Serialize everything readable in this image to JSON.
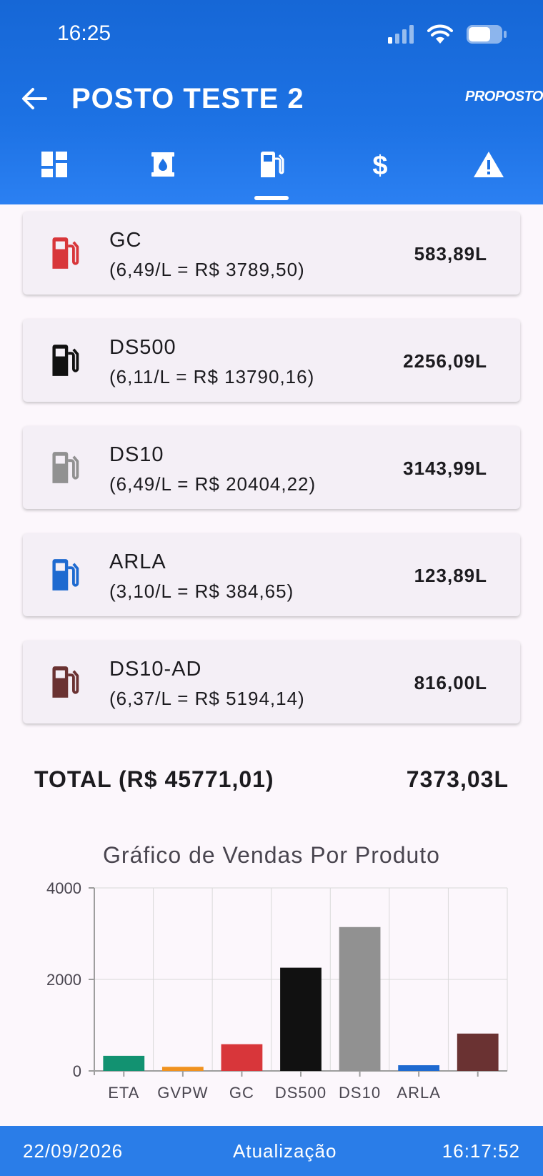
{
  "status": {
    "time": "16:25"
  },
  "header": {
    "title": "POSTO TESTE 2",
    "logo": "PROPOSTO"
  },
  "tabs": [
    {
      "icon": "dashboard-icon"
    },
    {
      "icon": "tank-icon"
    },
    {
      "icon": "fuel-pump-icon",
      "active": true
    },
    {
      "icon": "dollar-icon"
    },
    {
      "icon": "warning-icon"
    }
  ],
  "products": [
    {
      "name": "GC",
      "detail": "(6,49/L = R$ 3789,50)",
      "volume": "583,89L",
      "color": "#d8363a"
    },
    {
      "name": "DS500",
      "detail": "(6,11/L = R$ 13790,16)",
      "volume": "2256,09L",
      "color": "#111111"
    },
    {
      "name": "DS10",
      "detail": "(6,49/L = R$ 20404,22)",
      "volume": "3143,99L",
      "color": "#919191"
    },
    {
      "name": "ARLA",
      "detail": "(3,10/L = R$ 384,65)",
      "volume": "123,89L",
      "color": "#1e6ad0"
    },
    {
      "name": "DS10-AD",
      "detail": "(6,37/L = R$ 5194,14)",
      "volume": "816,00L",
      "color": "#6a3232"
    }
  ],
  "total": {
    "label": "TOTAL (R$ 45771,01)",
    "volume": "7373,03L"
  },
  "chart_data": {
    "type": "bar",
    "title": "Gráfico de Vendas Por Produto",
    "categories": [
      "ETA",
      "GVPW",
      "GC",
      "DS500",
      "DS10",
      "ARLA",
      ""
    ],
    "values": [
      330,
      90,
      584,
      2256,
      3144,
      124,
      816
    ],
    "colors": [
      "#129271",
      "#f0921f",
      "#d8363a",
      "#111111",
      "#919191",
      "#1e6ad0",
      "#6a3232"
    ],
    "ylim": [
      0,
      4000
    ],
    "yticks": [
      "0",
      "2000",
      "4000"
    ],
    "grid": true
  },
  "footer": {
    "date": "22/09/2026",
    "label": "Atualização",
    "time": "16:17:52"
  }
}
